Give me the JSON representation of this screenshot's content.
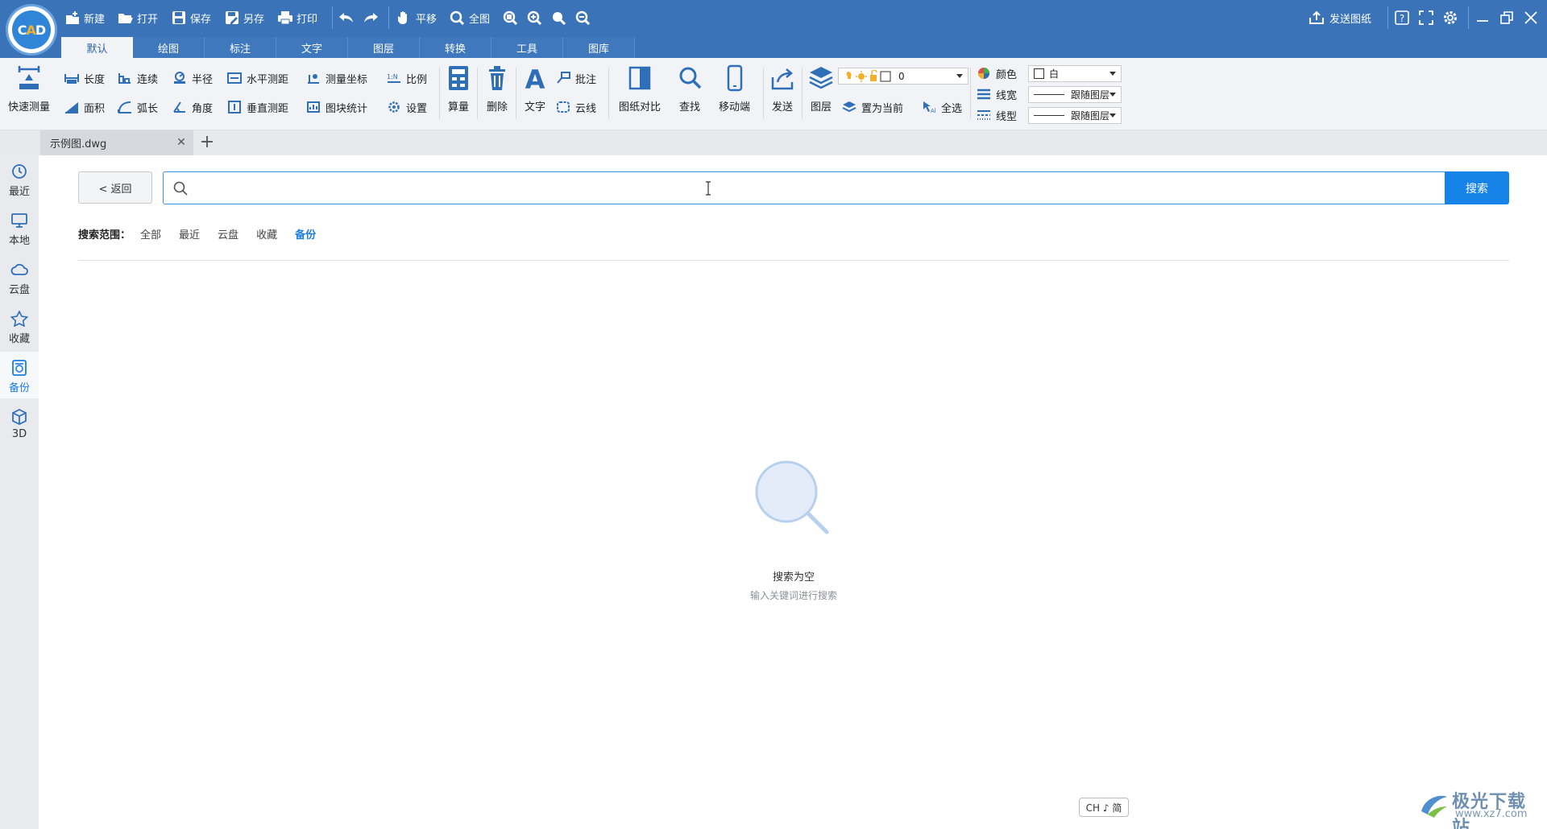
{
  "app": {
    "quick_access": [
      "新建",
      "打开",
      "保存",
      "另存",
      "打印"
    ],
    "view_tools": [
      "平移",
      "全图"
    ],
    "send_drawing": "发送图纸"
  },
  "tabs": [
    "默认",
    "绘图",
    "标注",
    "文字",
    "图层",
    "转换",
    "工具",
    "图库"
  ],
  "ribbon": {
    "quick_measure": "快速测量",
    "length": "长度",
    "area": "面积",
    "continuous": "连续",
    "arc_length": "弧长",
    "radius": "半径",
    "angle": "角度",
    "h_distance": "水平测距",
    "v_distance": "垂直测距",
    "measure_coord": "测量坐标",
    "block_stats": "图块统计",
    "scale": "比例",
    "settings": "设置",
    "calc": "算量",
    "delete": "删除",
    "text": "文字",
    "annotate": "批注",
    "cloud_line": "云线",
    "compare": "图纸对比",
    "find": "查找",
    "mobile": "移动端",
    "send": "发送",
    "layer": "图层",
    "set_current": "置为当前",
    "select_all": "全选",
    "layer_value": "0",
    "color_label": "颜色",
    "color_value": "白",
    "linewidth_label": "线宽",
    "linewidth_value": "跟随图层",
    "linetype_label": "线型",
    "linetype_value": "跟随图层"
  },
  "doc_tab": {
    "name": "示例图.dwg",
    "close": "✕",
    "add": "+"
  },
  "sidebar": [
    {
      "label": "最近",
      "icon": "clock-icon"
    },
    {
      "label": "本地",
      "icon": "monitor-icon"
    },
    {
      "label": "云盘",
      "icon": "cloud-icon"
    },
    {
      "label": "收藏",
      "icon": "star-icon"
    },
    {
      "label": "备份",
      "icon": "backup-icon"
    },
    {
      "label": "3D",
      "icon": "cube-icon"
    }
  ],
  "search": {
    "back_label": "< 返回",
    "placeholder": "",
    "button_label": "搜索",
    "scope_label": "搜索范围：",
    "scope_options": [
      "全部",
      "最近",
      "云盘",
      "收藏",
      "备份"
    ],
    "active_scope": "备份"
  },
  "empty": {
    "title": "搜索为空",
    "subtitle": "输入关键词进行搜索"
  },
  "ime": "CH ♪ 简",
  "watermark": {
    "title": "极光下载站",
    "url": "www.xz7.com"
  },
  "colors": {
    "titlebar": "#3a73b8",
    "accent": "#1583e8",
    "active_blue": "#1a7ee0"
  }
}
